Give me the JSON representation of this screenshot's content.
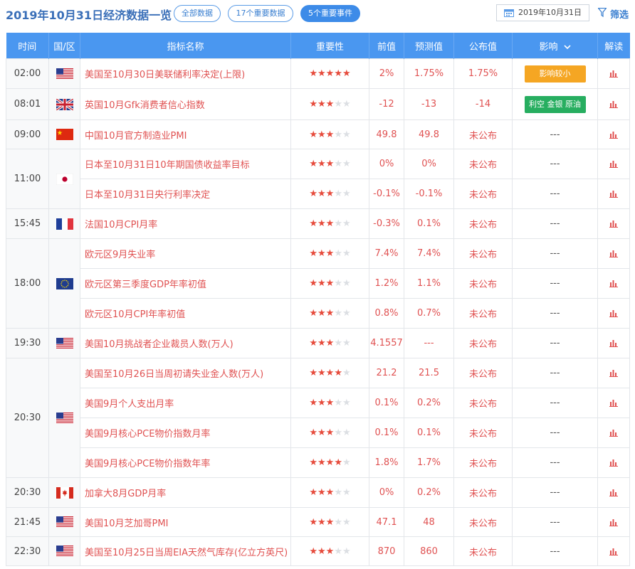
{
  "header": {
    "title": "2019年10月31日经济数据一览",
    "filters": [
      "全部数据",
      "17个重要数据",
      "5个重要事件"
    ],
    "active_filter_index": 2,
    "date": "2019年10月31日",
    "filter_label": "筛选"
  },
  "columns": [
    "时间",
    "国/区",
    "指标名称",
    "重要性",
    "前值",
    "预测值",
    "公布值",
    "影响",
    "解读"
  ],
  "groups": [
    {
      "time": "02:00",
      "flag": "us-flag-icon",
      "rows": [
        {
          "name": "美国至10月30日美联储利率决定(上限)",
          "stars": 5,
          "prev": "2%",
          "forecast": "1.75%",
          "actual": "1.75%",
          "impact": "影响较小",
          "impact_type": "orange"
        }
      ]
    },
    {
      "time": "08:01",
      "flag": "uk-flag-icon",
      "rows": [
        {
          "name": "英国10月Gfk消费者信心指数",
          "stars": 3,
          "prev": "-12",
          "forecast": "-13",
          "actual": "-14",
          "impact": "利空 金银 原油",
          "impact_type": "green"
        }
      ]
    },
    {
      "time": "09:00",
      "flag": "cn-flag-icon",
      "rows": [
        {
          "name": "中国10月官方制造业PMI",
          "stars": 3,
          "prev": "49.8",
          "forecast": "49.8",
          "actual": "未公布",
          "impact": "---",
          "impact_type": "none"
        }
      ]
    },
    {
      "time": "11:00",
      "flag": "jp-flag-icon",
      "rows": [
        {
          "name": "日本至10月31日10年期国债收益率目标",
          "stars": 3,
          "prev": "0%",
          "forecast": "0%",
          "actual": "未公布",
          "impact": "---",
          "impact_type": "none"
        },
        {
          "name": "日本至10月31日央行利率决定",
          "stars": 3,
          "prev": "-0.1%",
          "forecast": "-0.1%",
          "actual": "未公布",
          "impact": "---",
          "impact_type": "none"
        }
      ]
    },
    {
      "time": "15:45",
      "flag": "fr-flag-icon",
      "rows": [
        {
          "name": "法国10月CPI月率",
          "stars": 3,
          "prev": "-0.3%",
          "forecast": "0.1%",
          "actual": "未公布",
          "impact": "---",
          "impact_type": "none"
        }
      ]
    },
    {
      "time": "18:00",
      "flag": "eu-flag-icon",
      "rows": [
        {
          "name": "欧元区9月失业率",
          "stars": 3,
          "prev": "7.4%",
          "forecast": "7.4%",
          "actual": "未公布",
          "impact": "---",
          "impact_type": "none"
        },
        {
          "name": "欧元区第三季度GDP年率初值",
          "stars": 3,
          "prev": "1.2%",
          "forecast": "1.1%",
          "actual": "未公布",
          "impact": "---",
          "impact_type": "none"
        },
        {
          "name": "欧元区10月CPI年率初值",
          "stars": 3,
          "prev": "0.8%",
          "forecast": "0.7%",
          "actual": "未公布",
          "impact": "---",
          "impact_type": "none"
        }
      ]
    },
    {
      "time": "19:30",
      "flag": "us-flag-icon",
      "rows": [
        {
          "name": "美国10月挑战者企业裁员人数(万人)",
          "stars": 3,
          "prev": "4.1557",
          "forecast": "---",
          "actual": "未公布",
          "impact": "---",
          "impact_type": "none"
        }
      ]
    },
    {
      "time": "20:30",
      "flag": "us-flag-icon",
      "rows": [
        {
          "name": "美国至10月26日当周初请失业金人数(万人)",
          "stars": 4,
          "prev": "21.2",
          "forecast": "21.5",
          "actual": "未公布",
          "impact": "---",
          "impact_type": "none"
        },
        {
          "name": "美国9月个人支出月率",
          "stars": 3,
          "prev": "0.1%",
          "forecast": "0.2%",
          "actual": "未公布",
          "impact": "---",
          "impact_type": "none"
        },
        {
          "name": "美国9月核心PCE物价指数月率",
          "stars": 3,
          "prev": "0.1%",
          "forecast": "0.1%",
          "actual": "未公布",
          "impact": "---",
          "impact_type": "none"
        },
        {
          "name": "美国9月核心PCE物价指数年率",
          "stars": 4,
          "prev": "1.8%",
          "forecast": "1.7%",
          "actual": "未公布",
          "impact": "---",
          "impact_type": "none"
        }
      ]
    },
    {
      "time": "20:30",
      "flag": "ca-flag-icon",
      "rows": [
        {
          "name": "加拿大8月GDP月率",
          "stars": 3,
          "prev": "0%",
          "forecast": "0.2%",
          "actual": "未公布",
          "impact": "---",
          "impact_type": "none"
        }
      ]
    },
    {
      "time": "21:45",
      "flag": "us-flag-icon",
      "rows": [
        {
          "name": "美国10月芝加哥PMI",
          "stars": 3,
          "prev": "47.1",
          "forecast": "48",
          "actual": "未公布",
          "impact": "---",
          "impact_type": "none"
        }
      ]
    },
    {
      "time": "22:30",
      "flag": "us-flag-icon",
      "rows": [
        {
          "name": "美国至10月25日当周EIA天然气库存(亿立方英尺)",
          "stars": 3,
          "prev": "870",
          "forecast": "860",
          "actual": "未公布",
          "impact": "---",
          "impact_type": "none"
        }
      ]
    }
  ]
}
